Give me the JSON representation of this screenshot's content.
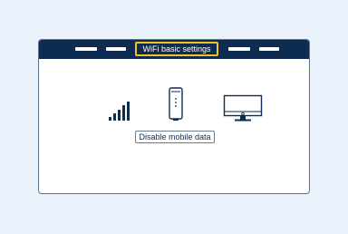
{
  "header": {
    "active_tab_label": "WiFi basic settings"
  },
  "main": {
    "icons": [
      "signal-strength-icon",
      "router-icon",
      "monitor-icon"
    ],
    "button_label": "Disable mobile data"
  },
  "colors": {
    "background": "#eaf3fb",
    "header": "#0e2c52",
    "highlight": "#f4c31f",
    "icon": "#0e2c52"
  }
}
